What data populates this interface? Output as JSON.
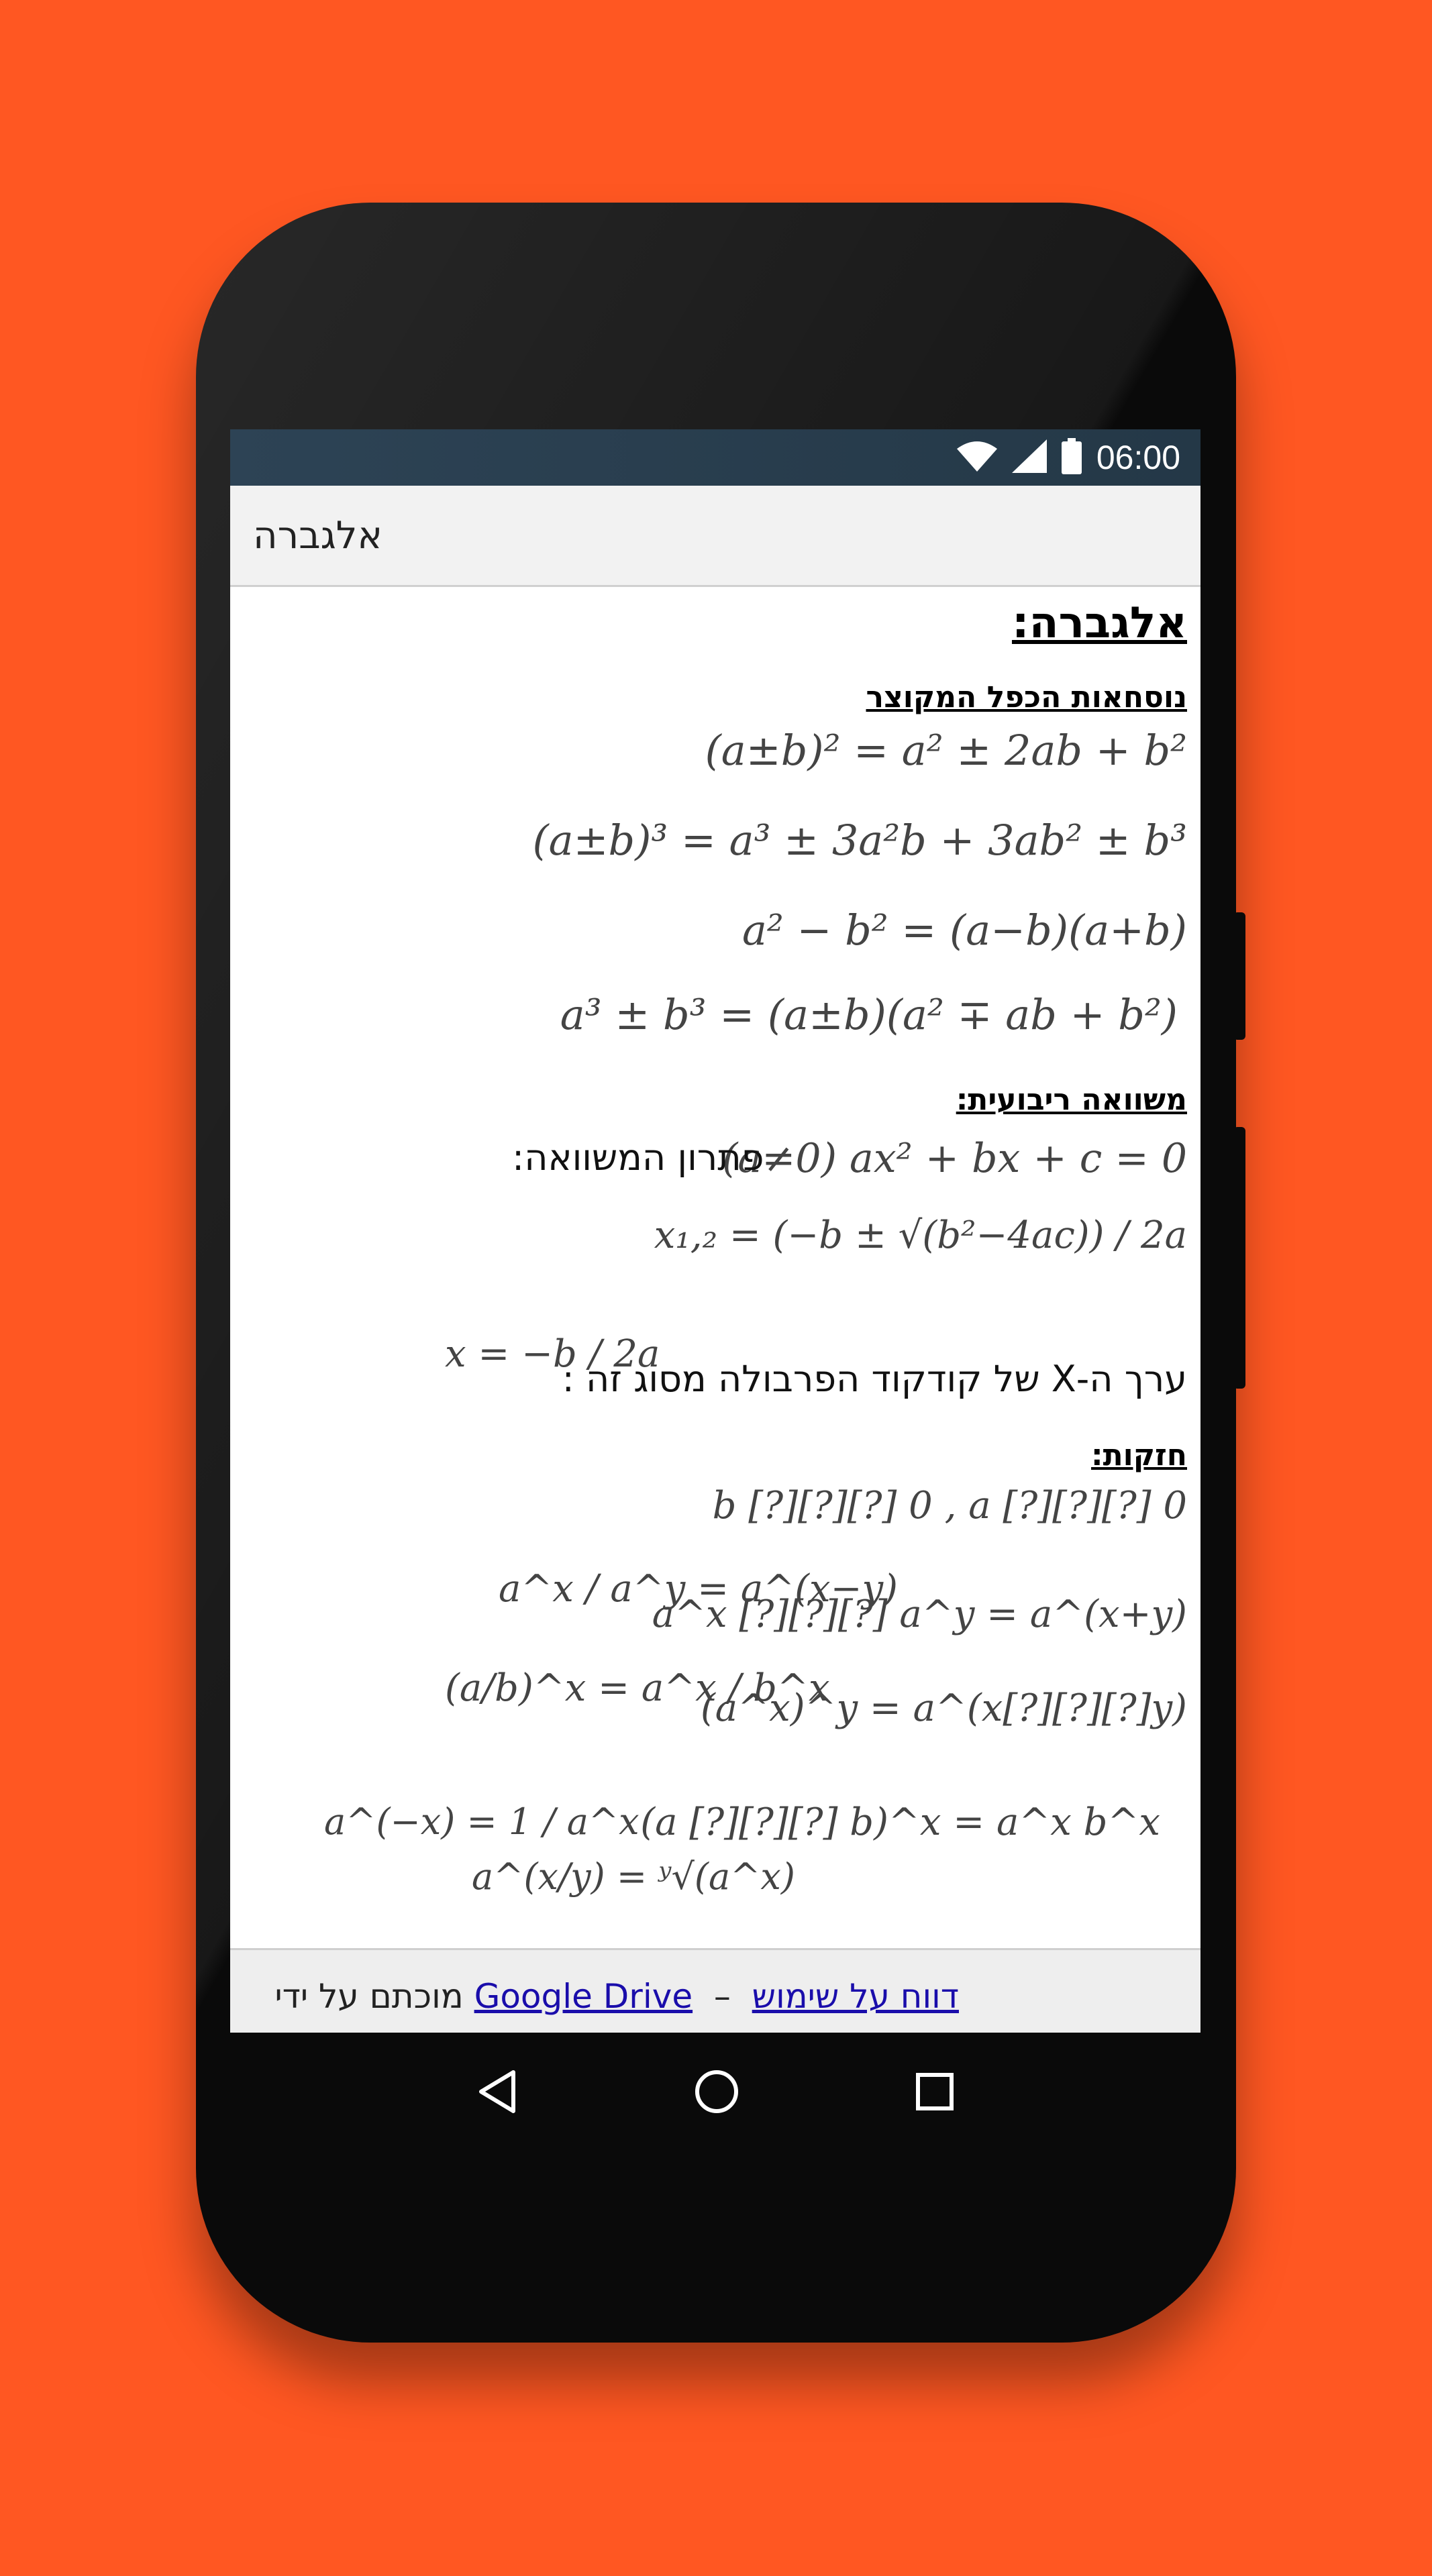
{
  "status_bar": {
    "time": "06:00",
    "icons": [
      "wifi-icon",
      "signal-icon",
      "battery-icon"
    ]
  },
  "app_bar": {
    "title": "אלגברה"
  },
  "content": {
    "heading": "אלגברה:",
    "section_short_mult": "נוסחאות הכפל המקוצר",
    "formula_1": "(a±b)² = a² ± 2ab + b²",
    "formula_2": "(a±b)³ = a³ ± 3a²b + 3ab² ± b³",
    "formula_3": "a² − b² = (a−b)(a+b)",
    "formula_4": "a³ ± b³ = (a±b)(a² ∓ ab + b²)",
    "section_quadratic": "משוואה ריבועית:",
    "quadratic_eq": "(a≠0) ax² + bx + c = 0",
    "solution_label": "פתרון המשוואה:",
    "quadratic_solution": "x₁,₂ = (−b ± √(b²−4ac)) / 2a",
    "vertex_label": "ערך ה-X של קודקוד הפרבולה מסוג זה :",
    "vertex_formula": "x = −b / 2a",
    "section_powers": "חזקות:",
    "powers_condition": "b [?][?][?] 0 , a [?][?][?] 0",
    "powers_mult": "a^x [?][?][?] a^y = a^(x+y)",
    "powers_div": "a^x / a^y = a^(x−y)",
    "powers_power": "(a^x)^y = a^(x[?][?][?]y)",
    "powers_frac": "(a/b)^x = a^x / b^x",
    "powers_prod": "(a [?][?][?] b)^x = a^x b^x",
    "powers_root": "a^(x/y) = ʸ√(a^x)",
    "powers_neg": "a^(−x) = 1 / a^x"
  },
  "footer": {
    "prefix": "מוכתם על ידי",
    "link_1": "Google Drive",
    "link_2": "דווח על שימוש"
  },
  "colors": {
    "background": "#ff5722",
    "status_bar": "#2d4355",
    "link": "#1a0dab"
  }
}
